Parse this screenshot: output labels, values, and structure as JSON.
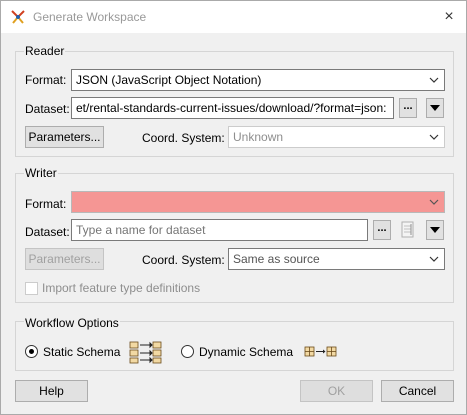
{
  "window": {
    "title": "Generate Workspace",
    "close_glyph": "×"
  },
  "reader": {
    "title": "Reader",
    "format_label": "Format:",
    "format_value": "JSON (JavaScript Object Notation)",
    "dataset_label": "Dataset:",
    "dataset_value": "et/rental-standards-current-issues/download/?format=json:",
    "browse_label": "...",
    "parameters_label": "Parameters...",
    "coord_label": "Coord. System:",
    "coord_value": "Unknown"
  },
  "writer": {
    "title": "Writer",
    "format_label": "Format:",
    "format_value": "",
    "required_color": "#f59694",
    "dataset_label": "Dataset:",
    "dataset_placeholder": "Type a name for dataset",
    "browse_label": "...",
    "parameters_label": "Parameters...",
    "coord_label": "Coord. System:",
    "coord_value": "Same as source",
    "import_label": "Import feature type definitions",
    "import_checked": false
  },
  "workflow": {
    "title": "Workflow Options",
    "static_label": "Static Schema",
    "static_selected": true,
    "dynamic_label": "Dynamic Schema",
    "dynamic_selected": false
  },
  "buttons": {
    "help": "Help",
    "ok": "OK",
    "cancel": "Cancel"
  }
}
